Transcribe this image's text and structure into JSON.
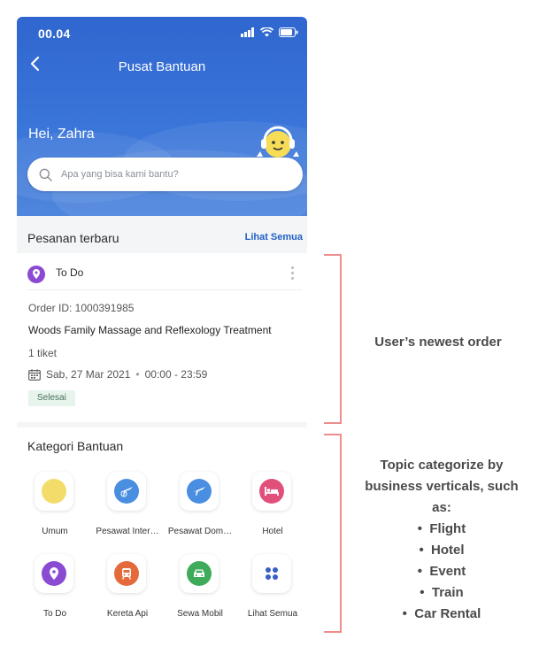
{
  "status_bar": {
    "time": "00.04"
  },
  "header": {
    "title": "Pusat Bantuan",
    "greeting": "Hei, Zahra",
    "search_placeholder": "Apa yang bisa kami bantu?",
    "brand_color": "#2f66cf"
  },
  "recent_orders": {
    "section_title": "Pesanan terbaru",
    "see_all": "Lihat Semua",
    "order": {
      "category": "To Do",
      "order_id": "Order ID: 1000391985",
      "name": "Woods Family Massage and Reflexology Treatment",
      "quantity": "1 tiket",
      "date": "Sab, 27 Mar 2021",
      "separator": "•",
      "time": "00:00 - 23:59",
      "status": "Selesai"
    }
  },
  "categories": {
    "section_title": "Kategori Bantuan",
    "items": [
      {
        "label": "Umum",
        "icon": "general-icon",
        "color": "#f3dc6a"
      },
      {
        "label": "Pesawat Inter…",
        "icon": "international-flight-icon",
        "color": "#4a8ee2"
      },
      {
        "label": "Pesawat Dom…",
        "icon": "domestic-flight-icon",
        "color": "#4a8ee2"
      },
      {
        "label": "Hotel",
        "icon": "hotel-icon",
        "color": "#e0507a"
      },
      {
        "label": "To Do",
        "icon": "to-do-icon",
        "color": "#8a4bd2"
      },
      {
        "label": "Kereta Api",
        "icon": "train-icon",
        "color": "#e56a3b"
      },
      {
        "label": "Sewa Mobil",
        "icon": "car-rental-icon",
        "color": "#3eab5a"
      },
      {
        "label": "Lihat Semua",
        "icon": "see-all-icon",
        "color": "#3a5fc4"
      }
    ]
  },
  "annotations": {
    "newest_order": "User’s newest order",
    "topics_intro": "Topic categorize by business verticals, such as:",
    "topics": [
      "Flight",
      "Hotel",
      "Event",
      "Train",
      "Car Rental"
    ],
    "bullet": "•",
    "bracket_color": "#ee8d8d"
  }
}
